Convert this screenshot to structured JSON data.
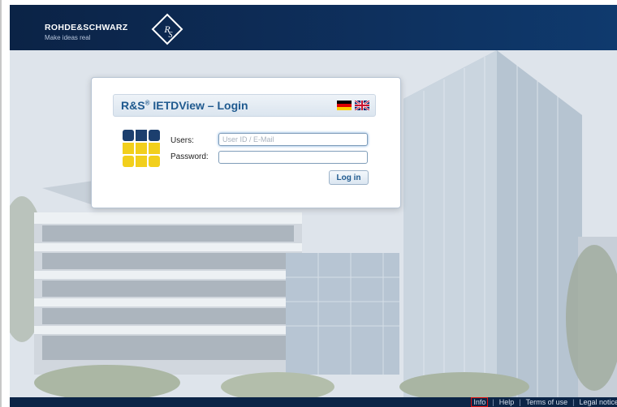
{
  "header": {
    "brand": "ROHDE&SCHWARZ",
    "tagline": "Make ideas real"
  },
  "login": {
    "title_prefix": "R&S",
    "title_reg": "®",
    "title_suffix": " IETDView – Login",
    "users_label": "Users:",
    "users_placeholder": "User ID / E-Mail",
    "password_label": "Password:",
    "login_button": "Log in",
    "languages": [
      "de-flag-icon",
      "uk-flag-icon"
    ]
  },
  "footer": {
    "links": [
      "Info",
      "Help",
      "Terms of use",
      "Legal notice"
    ],
    "separator": "|"
  },
  "colors": {
    "header_bg": "#0d2b55",
    "title_text": "#1f5a8f",
    "footer_bg": "#0c2547"
  }
}
